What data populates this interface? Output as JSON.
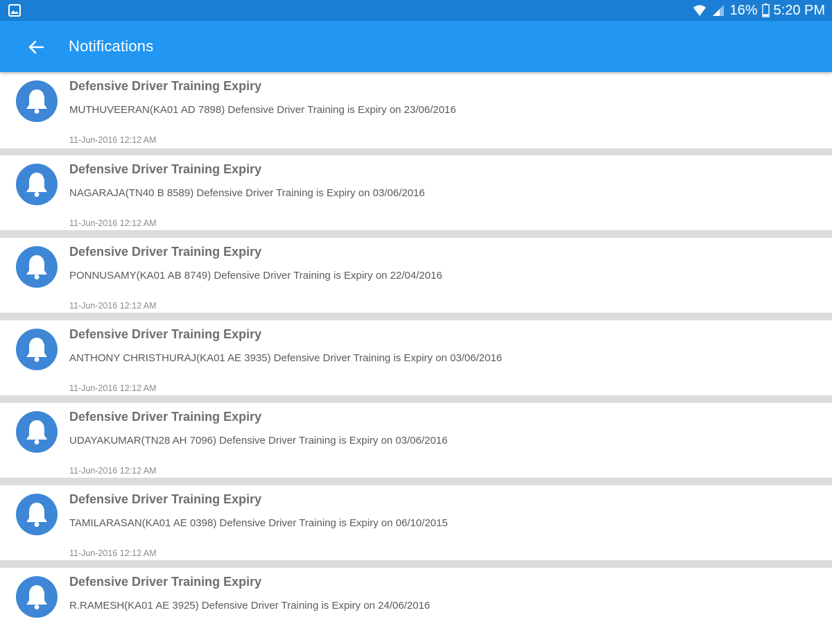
{
  "status_bar": {
    "battery": "16%",
    "time": "5:20 PM",
    "icons": [
      "gallery-icon",
      "wifi-icon",
      "signal-icon",
      "battery-icon"
    ]
  },
  "app_bar": {
    "title": "Notifications",
    "back_icon": "arrow-left-icon"
  },
  "colors": {
    "status_bar": "#1a7fd4",
    "app_bar": "#2196f3",
    "avatar": "#3d87d6",
    "divider": "#dcdcdc"
  },
  "notifications": [
    {
      "icon": "bell-icon",
      "title": "Defensive Driver Training Expiry",
      "body": "MUTHUVEERAN(KA01 AD 7898) Defensive Driver Training is Expiry on 23/06/2016",
      "time": "11-Jun-2016 12:12 AM"
    },
    {
      "icon": "bell-icon",
      "title": "Defensive Driver Training Expiry",
      "body": "NAGARAJA(TN40 B 8589) Defensive Driver Training is Expiry on 03/06/2016",
      "time": "11-Jun-2016 12:12 AM"
    },
    {
      "icon": "bell-icon",
      "title": "Defensive Driver Training Expiry",
      "body": "PONNUSAMY(KA01 AB 8749) Defensive Driver Training is Expiry on 22/04/2016",
      "time": "11-Jun-2016 12:12 AM"
    },
    {
      "icon": "bell-icon",
      "title": "Defensive Driver Training Expiry",
      "body": "ANTHONY CHRISTHURAJ(KA01 AE 3935) Defensive Driver Training is Expiry on 03/06/2016",
      "time": "11-Jun-2016 12:12 AM"
    },
    {
      "icon": "bell-icon",
      "title": "Defensive Driver Training Expiry",
      "body": "UDAYAKUMAR(TN28 AH 7096) Defensive Driver Training is Expiry on 03/06/2016",
      "time": "11-Jun-2016 12:12 AM"
    },
    {
      "icon": "bell-icon",
      "title": "Defensive Driver Training Expiry",
      "body": "TAMILARASAN(KA01 AE 0398) Defensive Driver Training is Expiry on 06/10/2015",
      "time": "11-Jun-2016 12:12 AM"
    },
    {
      "icon": "bell-icon",
      "title": "Defensive Driver Training Expiry",
      "body": "R.RAMESH(KA01 AE 3925) Defensive Driver Training is Expiry on 24/06/2016",
      "time": ""
    }
  ]
}
